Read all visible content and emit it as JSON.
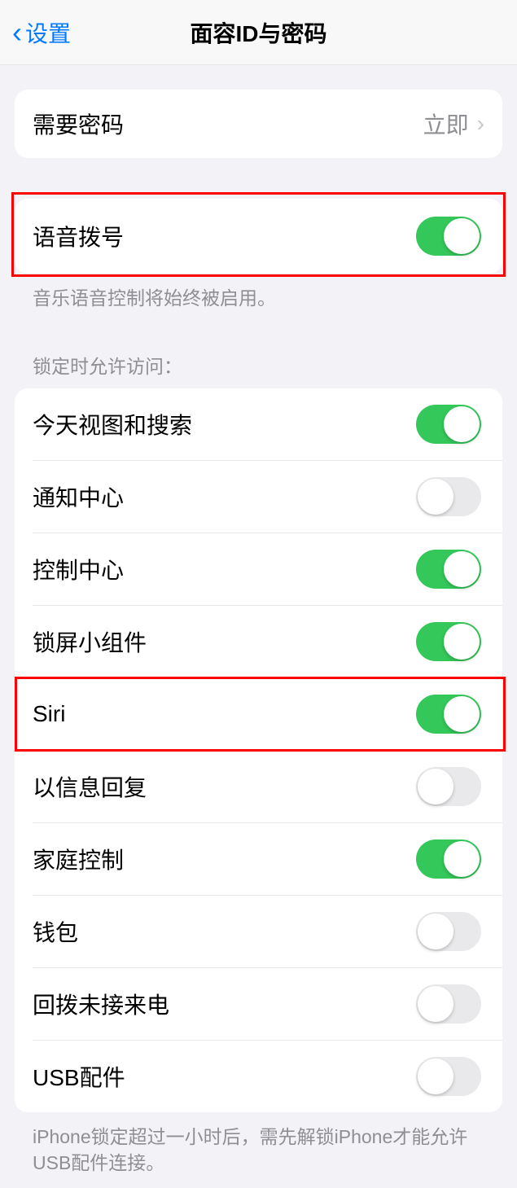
{
  "header": {
    "back_label": "设置",
    "title": "面容ID与密码"
  },
  "passcode_section": {
    "require_passcode_label": "需要密码",
    "require_passcode_value": "立即"
  },
  "voice_section": {
    "voice_dial_label": "语音拨号",
    "voice_dial_on": true,
    "footer": "音乐语音控制将始终被启用。"
  },
  "lock_section": {
    "header": "锁定时允许访问：",
    "items": [
      {
        "label": "今天视图和搜索",
        "on": true
      },
      {
        "label": "通知中心",
        "on": false
      },
      {
        "label": "控制中心",
        "on": true
      },
      {
        "label": "锁屏小组件",
        "on": true
      },
      {
        "label": "Siri",
        "on": true
      },
      {
        "label": "以信息回复",
        "on": false
      },
      {
        "label": "家庭控制",
        "on": true
      },
      {
        "label": "钱包",
        "on": false
      },
      {
        "label": "回拨未接来电",
        "on": false
      },
      {
        "label": "USB配件",
        "on": false
      }
    ],
    "footer": "iPhone锁定超过一小时后，需先解锁iPhone才能允许USB配件连接。"
  }
}
